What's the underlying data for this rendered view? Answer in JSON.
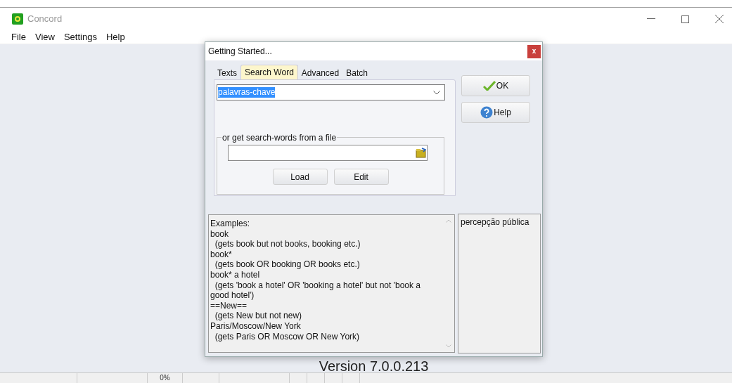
{
  "window": {
    "title": "Concord"
  },
  "menu": [
    "File",
    "View",
    "Settings",
    "Help"
  ],
  "dialog": {
    "title": "Getting Started...",
    "close": "x",
    "tabs": [
      {
        "label": "Texts",
        "selected": false
      },
      {
        "label": "Search Word",
        "selected": true
      },
      {
        "label": "Advanced",
        "selected": false
      },
      {
        "label": "Batch",
        "selected": false
      }
    ],
    "search_word": {
      "value": "palavras-chave"
    },
    "file_group": {
      "legend": "or get search-words from a file",
      "buttons": [
        "Load",
        "Edit"
      ]
    },
    "buttons": [
      {
        "label": "OK",
        "kind": "ok"
      },
      {
        "label": "Help",
        "kind": "help"
      }
    ],
    "examples": [
      "Examples:",
      "book",
      "  (gets book but not books, booking etc.)",
      "book*",
      "  (gets book OR booking OR books etc.)",
      "book* a hotel",
      "  (gets 'book a hotel' OR 'booking a hotel' but not 'book a good hotel')",
      "==New==",
      "  (gets New but not new)",
      "Paris/Moscow/New York",
      "  (gets Paris OR Moscow OR New York)"
    ],
    "history": [
      "percepção pública"
    ]
  },
  "version": "Version 7.0.0.213",
  "status_bar": {
    "progress": "0%"
  }
}
